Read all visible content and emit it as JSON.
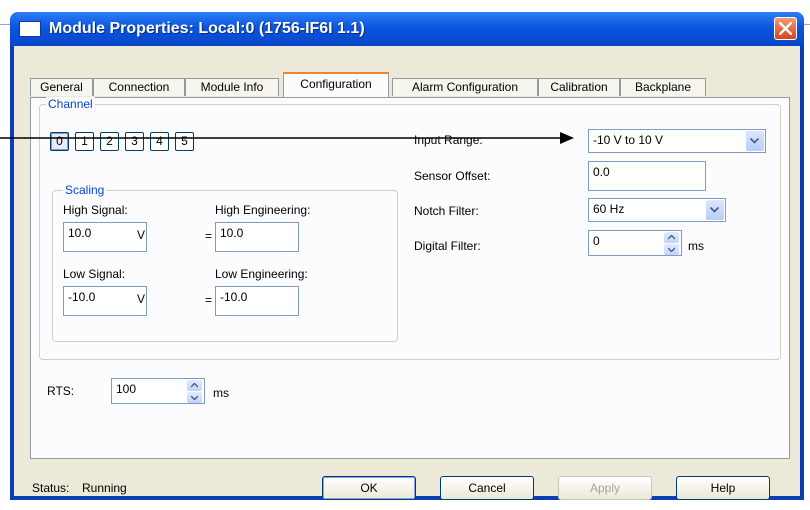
{
  "window": {
    "title": "Module Properties: Local:0 (1756-IF6I 1.1)"
  },
  "tabs": [
    {
      "label": "General"
    },
    {
      "label": "Connection"
    },
    {
      "label": "Module Info"
    },
    {
      "label": "Configuration",
      "active": true
    },
    {
      "label": "Alarm Configuration"
    },
    {
      "label": "Calibration"
    },
    {
      "label": "Backplane"
    }
  ],
  "channel": {
    "legend": "Channel",
    "buttons": [
      "0",
      "1",
      "2",
      "3",
      "4",
      "5"
    ],
    "selected": "0"
  },
  "scaling": {
    "legend": "Scaling",
    "high_signal_label": "High Signal:",
    "high_signal_value": "10.0",
    "high_signal_unit": "V",
    "high_eng_label": "High Engineering:",
    "high_eng_value": "10.0",
    "low_signal_label": "Low Signal:",
    "low_signal_value": "-10.0",
    "low_signal_unit": "V",
    "low_eng_label": "Low Engineering:",
    "low_eng_value": "-10.0",
    "equals": "="
  },
  "settings": {
    "input_range_label": "Input Range:",
    "input_range_value": "-10 V to 10 V",
    "sensor_offset_label": "Sensor Offset:",
    "sensor_offset_value": "0.0",
    "notch_filter_label": "Notch Filter:",
    "notch_filter_value": "60 Hz",
    "digital_filter_label": "Digital Filter:",
    "digital_filter_value": "0",
    "digital_filter_unit": "ms"
  },
  "rts": {
    "label": "RTS:",
    "value": "100",
    "unit": "ms"
  },
  "footer": {
    "status_label": "Status:",
    "status_value": "Running",
    "ok_label": "OK",
    "cancel_label": "Cancel",
    "apply_label": "Apply",
    "help_label": "Help"
  },
  "colors": {
    "titlebar": "#0a56e0",
    "group_legend": "#0046d5",
    "active_tab_highlight": "#e68b2c"
  }
}
